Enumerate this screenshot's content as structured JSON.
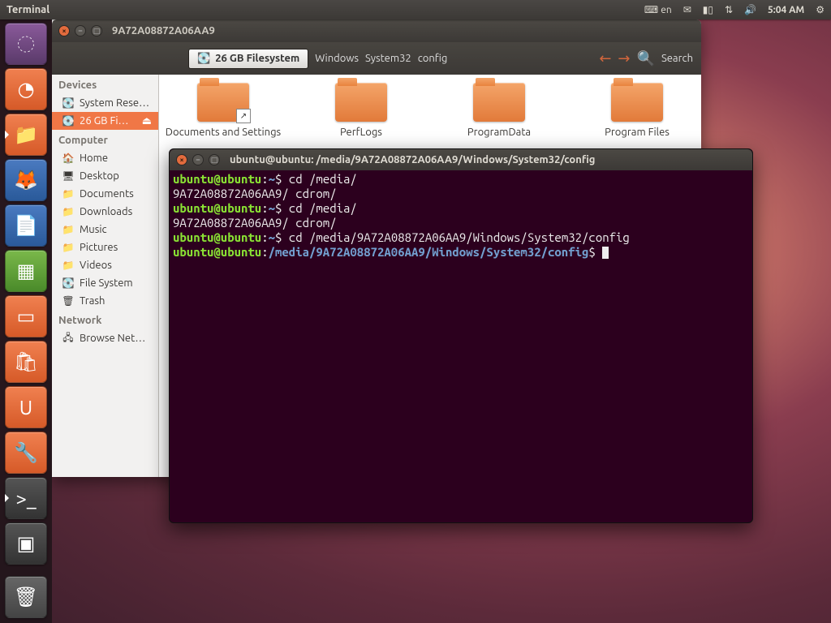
{
  "panel": {
    "app_title": "Terminal",
    "lang": "en",
    "time": "5:04 AM"
  },
  "launcher": [
    {
      "name": "dash",
      "style": "purple",
      "glyph": "◌"
    },
    {
      "name": "disk-install",
      "style": "",
      "glyph": "◔"
    },
    {
      "name": "files",
      "style": "",
      "glyph": "📁",
      "active": true
    },
    {
      "name": "firefox",
      "style": "blue",
      "glyph": "🦊"
    },
    {
      "name": "writer",
      "style": "blue",
      "glyph": "📄"
    },
    {
      "name": "calc",
      "style": "green",
      "glyph": "▦"
    },
    {
      "name": "impress",
      "style": "",
      "glyph": "▭"
    },
    {
      "name": "software",
      "style": "",
      "glyph": "🛍"
    },
    {
      "name": "ubuntu-one",
      "style": "",
      "glyph": "U"
    },
    {
      "name": "settings",
      "style": "",
      "glyph": "🔧"
    },
    {
      "name": "terminal",
      "style": "dark",
      "glyph": ">_",
      "active": true
    },
    {
      "name": "workspace",
      "style": "dark",
      "glyph": "▣"
    }
  ],
  "nautilus": {
    "title": "9A72A08872A06AA9",
    "path_button": "26 GB Filesystem",
    "breadcrumbs": [
      "Windows",
      "System32",
      "config"
    ],
    "search_label": "Search",
    "folders": [
      {
        "label": "Documents and Settings",
        "link": true
      },
      {
        "label": "PerfLogs",
        "link": false
      },
      {
        "label": "ProgramData",
        "link": false
      },
      {
        "label": "Program Files",
        "link": false
      }
    ],
    "sidebar": {
      "devices_head": "Devices",
      "devices": [
        {
          "label": "System Rese…",
          "icon": "💽"
        },
        {
          "label": "26 GB Fi…",
          "icon": "💽",
          "selected": true,
          "eject": true
        }
      ],
      "computer_head": "Computer",
      "computer": [
        {
          "label": "Home",
          "icon": "🏠"
        },
        {
          "label": "Desktop",
          "icon": "🖥"
        },
        {
          "label": "Documents",
          "icon": "📁"
        },
        {
          "label": "Downloads",
          "icon": "📁"
        },
        {
          "label": "Music",
          "icon": "📁"
        },
        {
          "label": "Pictures",
          "icon": "📁"
        },
        {
          "label": "Videos",
          "icon": "📁"
        },
        {
          "label": "File System",
          "icon": "💽"
        },
        {
          "label": "Trash",
          "icon": "🗑"
        }
      ],
      "network_head": "Network",
      "network": [
        {
          "label": "Browse Net…",
          "icon": "🖧"
        }
      ]
    }
  },
  "terminal": {
    "title": "ubuntu@ubuntu: /media/9A72A08872A06AA9/Windows/System32/config",
    "lines": [
      {
        "type": "prompt",
        "user": "ubuntu@ubuntu",
        "path": "~",
        "cmd": "cd /media/"
      },
      {
        "type": "out",
        "text": "9A72A08872A06AA9/ cdrom/"
      },
      {
        "type": "prompt",
        "user": "ubuntu@ubuntu",
        "path": "~",
        "cmd": "cd /media/"
      },
      {
        "type": "out",
        "text": "9A72A08872A06AA9/ cdrom/"
      },
      {
        "type": "prompt",
        "user": "ubuntu@ubuntu",
        "path": "~",
        "cmd": "cd /media/9A72A08872A06AA9/Windows/System32/config"
      },
      {
        "type": "prompt",
        "user": "ubuntu@ubuntu",
        "path": "/media/9A72A08872A06AA9/Windows/System32/config",
        "cmd": "",
        "cursor": true
      }
    ]
  }
}
